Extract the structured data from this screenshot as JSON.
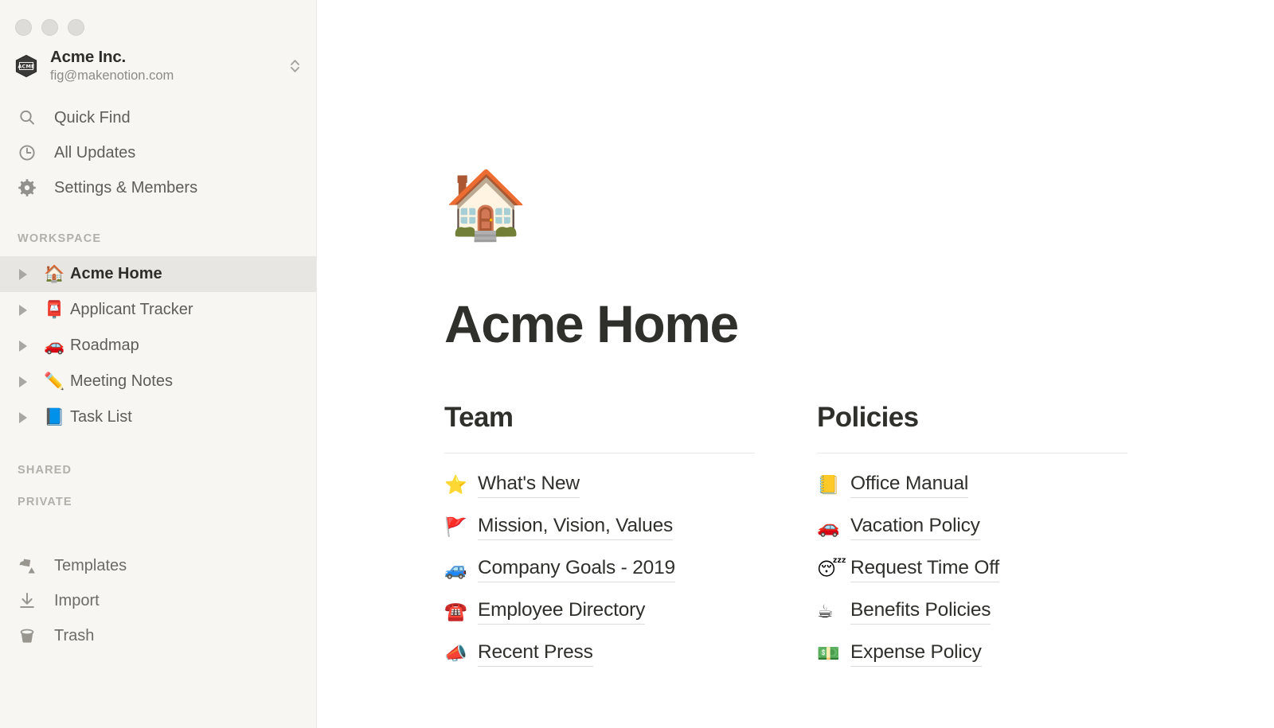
{
  "window": {
    "traffic_lights": [
      "close",
      "minimize",
      "zoom"
    ]
  },
  "sidebar": {
    "workspace": {
      "logo_text": "ACME",
      "name": "Acme Inc.",
      "email": "fig@makenotion.com",
      "switcher_icon": "chevron-up-down-icon"
    },
    "top_nav": [
      {
        "label": "Quick Find",
        "icon": "search-icon"
      },
      {
        "label": "All Updates",
        "icon": "clock-icon"
      },
      {
        "label": "Settings & Members",
        "icon": "gear-icon"
      }
    ],
    "sections": [
      {
        "title": "WORKSPACE"
      },
      {
        "title": "SHARED"
      },
      {
        "title": "PRIVATE"
      }
    ],
    "workspace_pages": [
      {
        "emoji": "🏠",
        "label": "Acme Home",
        "selected": true
      },
      {
        "emoji": "📮",
        "label": "Applicant Tracker",
        "selected": false
      },
      {
        "emoji": "🚗",
        "label": "Roadmap",
        "selected": false
      },
      {
        "emoji": "✏️",
        "label": "Meeting Notes",
        "selected": false
      },
      {
        "emoji": "📘",
        "label": "Task List",
        "selected": false
      }
    ],
    "bottom_nav": [
      {
        "label": "Templates",
        "icon": "templates-icon"
      },
      {
        "label": "Import",
        "icon": "import-download-icon"
      },
      {
        "label": "Trash",
        "icon": "trash-icon"
      }
    ]
  },
  "page": {
    "emoji": "🏠",
    "title": "Acme Home",
    "columns": [
      {
        "heading": "Team",
        "links": [
          {
            "emoji": "⭐",
            "label": "What's New"
          },
          {
            "emoji": "🚩",
            "label": "Mission, Vision, Values"
          },
          {
            "emoji": "🚙",
            "label": "Company Goals - 2019"
          },
          {
            "emoji": "☎️",
            "label": "Employee Directory"
          },
          {
            "emoji": "📣",
            "label": "Recent Press"
          }
        ]
      },
      {
        "heading": "Policies",
        "links": [
          {
            "emoji": "📒",
            "label": "Office Manual"
          },
          {
            "emoji": "🚗",
            "label": "Vacation Policy"
          },
          {
            "emoji": "😴",
            "label": "Request Time Off"
          },
          {
            "emoji": "☕",
            "label": "Benefits Policies"
          },
          {
            "emoji": "💵",
            "label": "Expense Policy"
          }
        ]
      }
    ]
  },
  "colors": {
    "sidebar_bg": "#f7f6f3",
    "selected_row": "#e7e6e2",
    "text_primary": "#2f2f2c",
    "text_secondary": "#5f5d58",
    "text_muted": "#b3b0aa",
    "divider": "#ebeae7"
  }
}
